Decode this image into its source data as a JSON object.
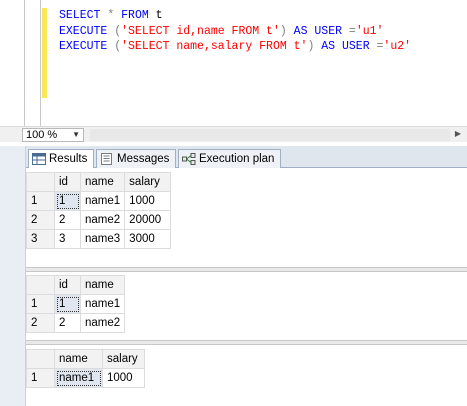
{
  "editor": {
    "lines": [
      [
        {
          "t": "SELECT",
          "c": "kw"
        },
        {
          "t": " ",
          "c": "txt"
        },
        {
          "t": "*",
          "c": "gr"
        },
        {
          "t": " ",
          "c": "txt"
        },
        {
          "t": "FROM",
          "c": "kw"
        },
        {
          "t": " t",
          "c": "txt"
        }
      ],
      [
        {
          "t": "EXECUTE",
          "c": "kw"
        },
        {
          "t": " ",
          "c": "txt"
        },
        {
          "t": "(",
          "c": "gr"
        },
        {
          "t": "'SELECT id,name FROM t'",
          "c": "str"
        },
        {
          "t": ")",
          "c": "gr"
        },
        {
          "t": " ",
          "c": "txt"
        },
        {
          "t": "AS",
          "c": "kw"
        },
        {
          "t": " ",
          "c": "txt"
        },
        {
          "t": "USER",
          "c": "kw"
        },
        {
          "t": " ",
          "c": "txt"
        },
        {
          "t": "=",
          "c": "gr"
        },
        {
          "t": "'u1'",
          "c": "str"
        }
      ],
      [
        {
          "t": "EXECUTE",
          "c": "kw"
        },
        {
          "t": " ",
          "c": "txt"
        },
        {
          "t": "(",
          "c": "gr"
        },
        {
          "t": "'SELECT name,salary FROM t'",
          "c": "str"
        },
        {
          "t": ")",
          "c": "gr"
        },
        {
          "t": " ",
          "c": "txt"
        },
        {
          "t": "AS",
          "c": "kw"
        },
        {
          "t": " ",
          "c": "txt"
        },
        {
          "t": "USER",
          "c": "kw"
        },
        {
          "t": " ",
          "c": "txt"
        },
        {
          "t": "=",
          "c": "gr"
        },
        {
          "t": "'u2'",
          "c": "str"
        }
      ]
    ]
  },
  "zoom": {
    "value": "100 %"
  },
  "tabs": [
    {
      "label": "Results",
      "icon": "grid-icon",
      "active": true
    },
    {
      "label": "Messages",
      "icon": "messages-icon",
      "active": false
    },
    {
      "label": "Execution plan",
      "icon": "execution-plan-icon",
      "active": false
    }
  ],
  "results": [
    {
      "columns": [
        "id",
        "name",
        "salary"
      ],
      "rows": [
        [
          "1",
          "1",
          "name1",
          "1000"
        ],
        [
          "2",
          "2",
          "name2",
          "20000"
        ],
        [
          "3",
          "3",
          "name3",
          "3000"
        ]
      ]
    },
    {
      "columns": [
        "id",
        "name"
      ],
      "rows": [
        [
          "1",
          "1",
          "name1"
        ],
        [
          "2",
          "2",
          "name2"
        ]
      ]
    },
    {
      "columns": [
        "name",
        "salary"
      ],
      "rows": [
        [
          "1",
          "name1",
          "1000"
        ]
      ]
    }
  ]
}
